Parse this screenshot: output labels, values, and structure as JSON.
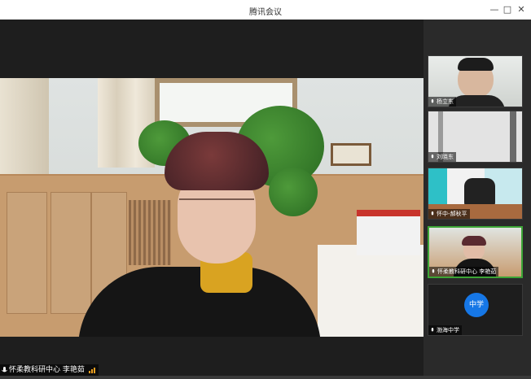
{
  "window": {
    "title": "腾讯会议",
    "controls": {
      "minimize": "—",
      "maximize": "□",
      "close": "✕"
    }
  },
  "main_speaker": {
    "name": "怀柔教科研中心  李艳茹"
  },
  "participants": [
    {
      "label": "杨立东"
    },
    {
      "label": "刘晓东"
    },
    {
      "label": "怀中-郝秋平"
    },
    {
      "label": "怀柔教科研中心  李艳茹"
    },
    {
      "label": "渤海中学",
      "avatar_text": "中学"
    }
  ],
  "colors": {
    "accent": "#1677e6",
    "signal": "#f0a020"
  }
}
